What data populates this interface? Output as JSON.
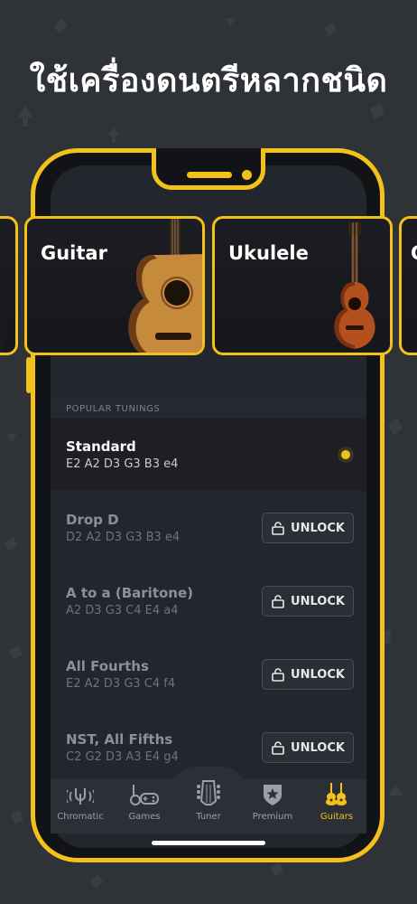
{
  "headline": "ใช้เครื่องดนตรีหลากชนิด",
  "colors": {
    "accent": "#f2c21a",
    "background": "#2f3237",
    "screen": "#23262c"
  },
  "instruments": [
    {
      "label": "Guitar"
    },
    {
      "label": "Ukulele"
    },
    {
      "label": "C"
    }
  ],
  "section_header": "POPULAR TUNINGS",
  "tunings": [
    {
      "name": "Standard",
      "notes": "E2 A2 D3 G3 B3 e4",
      "selected": true
    },
    {
      "name": "Drop D",
      "notes": "D2 A2 D3 G3 B3 e4",
      "action": "UNLOCK"
    },
    {
      "name": "A to a (Baritone)",
      "notes": "A2 D3 G3 C4 E4 a4",
      "action": "UNLOCK"
    },
    {
      "name": "All Fourths",
      "notes": "E2 A2 D3 G3 C4 f4",
      "action": "UNLOCK"
    },
    {
      "name": "NST, All Fifths",
      "notes": "C2 G2 D3 A3 E4 g4",
      "action": "UNLOCK"
    }
  ],
  "tabs": [
    {
      "label": "Chromatic",
      "icon": "chromatic-icon"
    },
    {
      "label": "Games",
      "icon": "games-icon"
    },
    {
      "label": "Tuner",
      "icon": "tuner-headstock-icon"
    },
    {
      "label": "Premium",
      "icon": "premium-badge-icon"
    },
    {
      "label": "Guitars",
      "icon": "guitars-icon",
      "active": true
    }
  ]
}
